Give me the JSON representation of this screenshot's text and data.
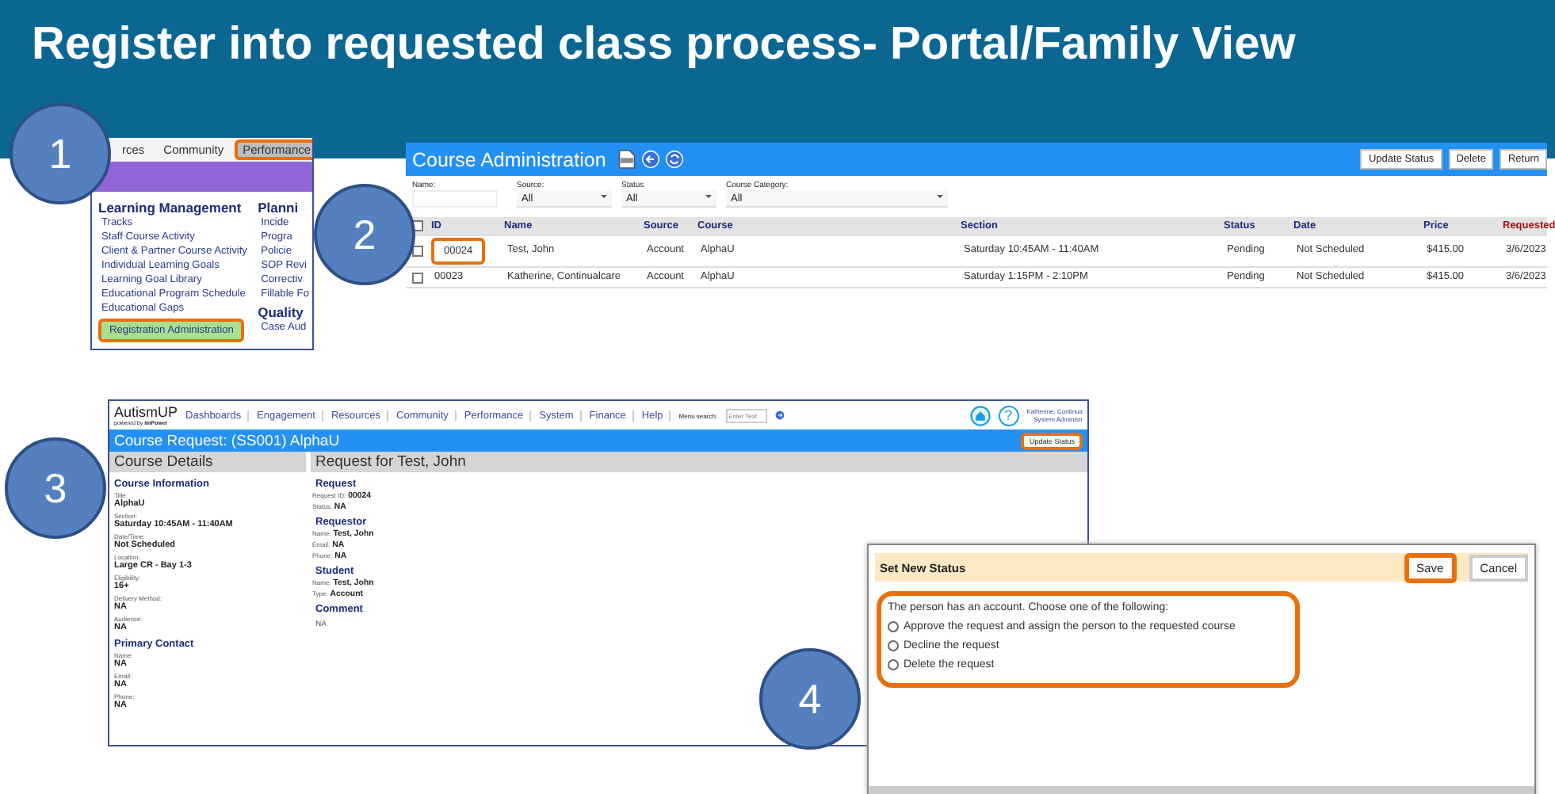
{
  "slide_title": "Register into requested class process- Portal/Family View",
  "steps": [
    "1",
    "2",
    "3",
    "4"
  ],
  "menu": {
    "tabs": [
      {
        "label": "rces",
        "selected": false,
        "highlighted": false
      },
      {
        "label": "Community",
        "selected": false,
        "highlighted": false
      },
      {
        "label": "Performance",
        "selected": true,
        "highlighted": true
      }
    ],
    "columns": [
      {
        "items": [
          {
            "kind": "heading",
            "label": "Learning Management"
          },
          {
            "kind": "link",
            "label": "Tracks",
            "selected": false,
            "highlighted": false
          },
          {
            "kind": "link",
            "label": "Staff Course Activity",
            "selected": false,
            "highlighted": false
          },
          {
            "kind": "link",
            "label": "Client & Partner Course Activity",
            "selected": false,
            "highlighted": false
          },
          {
            "kind": "link",
            "label": "Individual Learning Goals",
            "selected": false,
            "highlighted": false
          },
          {
            "kind": "link",
            "label": "Learning Goal Library",
            "selected": false,
            "highlighted": false
          },
          {
            "kind": "link",
            "label": "Educational Program Schedule",
            "selected": false,
            "highlighted": false
          },
          {
            "kind": "link",
            "label": "Educational Gaps",
            "selected": false,
            "highlighted": false
          },
          {
            "kind": "link",
            "label": "Registration Administration",
            "selected": true,
            "highlighted": true
          }
        ]
      },
      {
        "items": [
          {
            "kind": "heading",
            "label": "Planni"
          },
          {
            "kind": "link",
            "label": "Incide",
            "selected": false,
            "highlighted": false
          },
          {
            "kind": "link",
            "label": "Progra",
            "selected": false,
            "highlighted": false
          },
          {
            "kind": "link",
            "label": "Policie",
            "selected": false,
            "highlighted": false
          },
          {
            "kind": "link",
            "label": "SOP Revi",
            "selected": false,
            "highlighted": false
          },
          {
            "kind": "link",
            "label": "Correctiv",
            "selected": false,
            "highlighted": false
          },
          {
            "kind": "link",
            "label": "Fillable Fo",
            "selected": false,
            "highlighted": false
          },
          {
            "kind": "heading",
            "label": "Quality"
          },
          {
            "kind": "link",
            "label": "Case Aud",
            "selected": false,
            "highlighted": false
          }
        ]
      }
    ]
  },
  "course_admin": {
    "title": "Course Administration",
    "buttons": [
      "Update Status",
      "Delete",
      "Return"
    ],
    "filters": [
      {
        "label": "Name:",
        "kind": "text"
      },
      {
        "label": "Source:",
        "kind": "select",
        "value": "All"
      },
      {
        "label": "Status",
        "kind": "select",
        "value": "All"
      },
      {
        "label": "Course Category:",
        "kind": "select",
        "value": "All"
      }
    ],
    "all_checked": false,
    "columns": [
      "ID",
      "Name",
      "Source",
      "Course",
      "Section",
      "Status",
      "Date",
      "Price",
      "Requested"
    ],
    "rows": [
      {
        "checked": false,
        "highlighted": true,
        "cells": [
          "00024",
          "Test, John",
          "Account",
          "AlphaU",
          "Saturday 10:45AM - 11:40AM",
          "Pending",
          "Not Scheduled",
          "$415.00",
          "3/6/2023"
        ]
      },
      {
        "checked": false,
        "highlighted": false,
        "cells": [
          "00023",
          "Katherine, Continualcare",
          "Account",
          "AlphaU",
          "Saturday 1:15PM - 2:10PM",
          "Pending",
          "Not Scheduled",
          "$415.00",
          "3/6/2023"
        ]
      }
    ]
  },
  "course_request": {
    "app_name": "AutismUP",
    "powered_by": "powered by",
    "brand": "imPower",
    "nav": [
      "Dashboards",
      "Engagement",
      "Resources",
      "Community",
      "Performance",
      "System",
      "Finance",
      "Help"
    ],
    "search_label": "Menu search:",
    "search_placeholder": "Enter Text",
    "help_icon": "?",
    "user_name": "Katherine, Continua",
    "user_role": "System Administr",
    "title": "Course Request: (SS001) AlphaU",
    "button": {
      "label": "Update Status",
      "highlighted": true
    },
    "details": {
      "heading": "Course Details",
      "sections": [
        {
          "title": "Course Information",
          "fields": [
            {
              "label": "Title:",
              "value": "AlphaU"
            },
            {
              "label": "Section:",
              "value": "Saturday 10:45AM - 11:40AM"
            },
            {
              "label": "Date/Time:",
              "value": "Not Scheduled"
            },
            {
              "label": "Location:",
              "value": "Large CR - Bay 1-3"
            },
            {
              "label": "Eligibility:",
              "value": "16+"
            },
            {
              "label": "Delivery Method:",
              "value": "NA"
            },
            {
              "label": "Audience:",
              "value": "NA"
            }
          ]
        },
        {
          "title": "Primary Contact",
          "fields": [
            {
              "label": "Name:",
              "value": "NA"
            },
            {
              "label": "Email:",
              "value": "NA"
            },
            {
              "label": "Phone:",
              "value": "NA"
            }
          ]
        }
      ]
    },
    "request": {
      "heading": "Request for Test, John",
      "sections": [
        {
          "title": "Request",
          "fields": [
            {
              "label": "Request ID:",
              "value": "00024"
            },
            {
              "label": "Status:",
              "value": "NA"
            }
          ]
        },
        {
          "title": "Requestor",
          "fields": [
            {
              "label": "Name:",
              "value": "Test, John"
            },
            {
              "label": "Email:",
              "value": "NA"
            },
            {
              "label": "Phone:",
              "value": "NA"
            }
          ]
        },
        {
          "title": "Student",
          "fields": [
            {
              "label": "Name:",
              "value": "Test, John"
            },
            {
              "label": "Type:",
              "value": "Account"
            }
          ]
        },
        {
          "title": "Comment",
          "fields": [
            {
              "value": "NA"
            }
          ]
        }
      ]
    }
  },
  "dialog": {
    "title": "Set New Status",
    "buttons": [
      {
        "label": "Save",
        "highlighted": true
      },
      {
        "label": "Cancel",
        "highlighted": false
      }
    ],
    "prompt": "The person has an account. Choose one of the following:",
    "options_highlighted": true,
    "options": [
      {
        "label": "Approve the request and assign the person to the requested course",
        "selected": false
      },
      {
        "label": "Decline the request",
        "selected": false
      },
      {
        "label": "Delete the request",
        "selected": false
      }
    ]
  }
}
